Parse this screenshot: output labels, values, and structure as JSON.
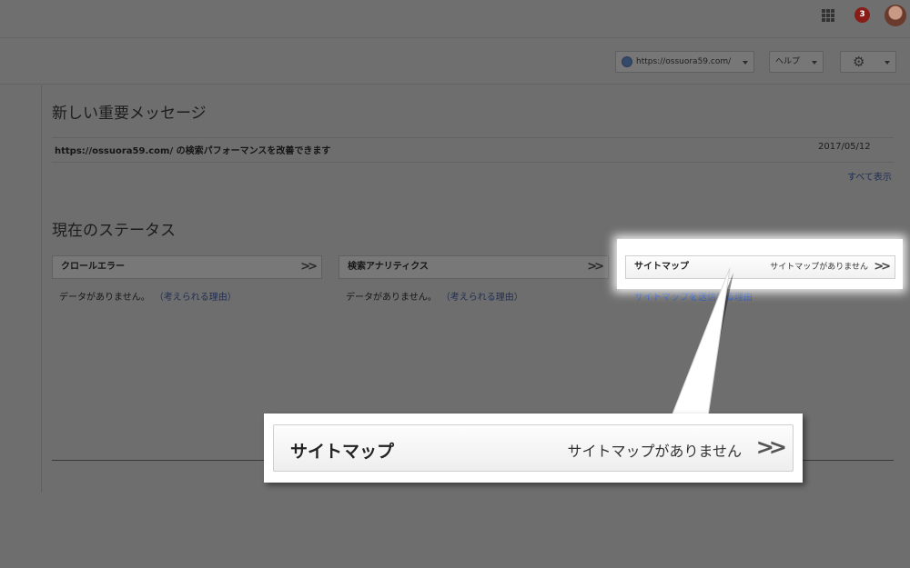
{
  "topbar": {
    "notification_count": "3"
  },
  "toolbar": {
    "site_selector": "https://ossuora59.com/",
    "help_label": "ヘルプ"
  },
  "messages": {
    "heading": "新しい重要メッセージ",
    "item_text": "https://ossuora59.com/ の検索パフォーマンスを改善できます",
    "item_date": "2017/05/12",
    "show_all": "すべて表示"
  },
  "status": {
    "heading": "現在のステータス",
    "cards": [
      {
        "title": "クロールエラー",
        "no_data": "データがありません。",
        "reason_link": "（考えられる理由）"
      },
      {
        "title": "検索アナリティクス",
        "no_data": "データがありません。",
        "reason_link": "（考えられる理由）"
      },
      {
        "title": "サイトマップ",
        "status": "サイトマップがありません",
        "link": "サイトマップを送信する理由"
      }
    ]
  },
  "callout": {
    "title": "サイトマップ",
    "status": "サイトマップがありません"
  }
}
